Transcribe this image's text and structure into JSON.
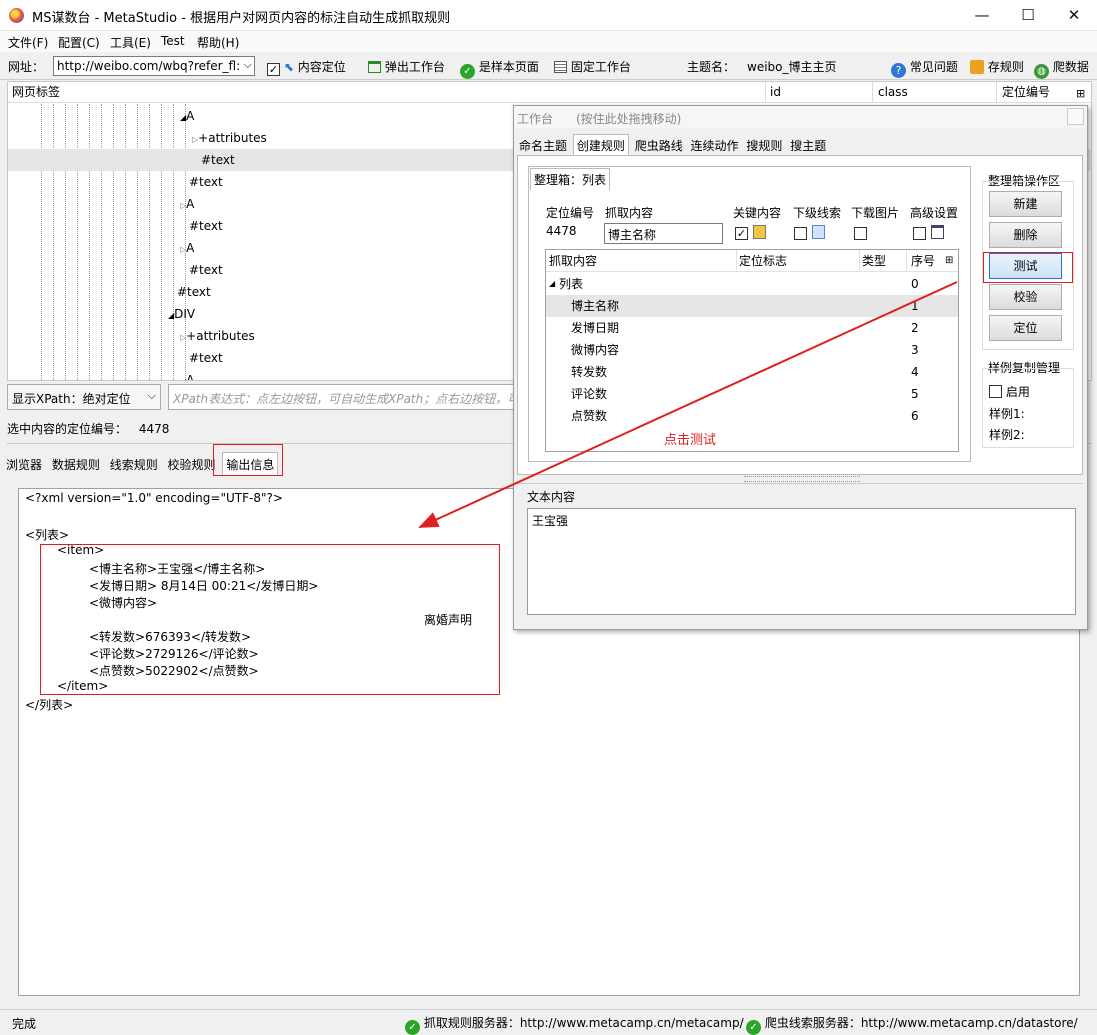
{
  "window": {
    "title": "MS谋数台 - MetaStudio - 根据用户对网页内容的标注自动生成抓取规则",
    "minimize": "—",
    "maximize": "☐",
    "close": "✕"
  },
  "menu": [
    "文件(F)",
    "配置(C)",
    "工具(E)",
    "Test",
    "帮助(H)"
  ],
  "toolbar": {
    "url_label": "网址：",
    "url_value": "http://weibo.com/wbq?refer_fl:",
    "content_locate": "内容定位",
    "popup_workbench": "弹出工作台",
    "is_sample_page": "是样本页面",
    "fix_workbench": "固定工作台",
    "theme_label": "主题名：",
    "theme_value": "weibo_博主主页",
    "faq": "常见问题",
    "save_rule": "存规则",
    "crawl_data": "爬数据"
  },
  "tree": {
    "headers": [
      "网页标签",
      "id",
      "class",
      "定位编号"
    ],
    "rows": [
      {
        "prefix": "◢",
        "label": "A"
      },
      {
        "prefix": "▷",
        "label": "+attributes"
      },
      {
        "prefix": "",
        "label": "#text"
      },
      {
        "prefix": "",
        "label": "#text"
      },
      {
        "prefix": "▷",
        "label": "A"
      },
      {
        "prefix": "",
        "label": "#text"
      },
      {
        "prefix": "▷",
        "label": "A"
      },
      {
        "prefix": "",
        "label": "#text"
      },
      {
        "prefix": "",
        "label": "#text"
      },
      {
        "prefix": "◢",
        "label": "DIV"
      },
      {
        "prefix": "▷",
        "label": "+attributes"
      },
      {
        "prefix": "",
        "label": "#text"
      },
      {
        "prefix": "◢",
        "label": "A"
      }
    ]
  },
  "xpath": {
    "mode": "显示XPath：绝对定位",
    "placeholder": "XPath表达式：点左边按钮，可自动生成XPath；点右边按钮，可"
  },
  "selected": {
    "label": "选中内容的定位编号：",
    "value": "4478"
  },
  "bottom_tabs": [
    "浏览器",
    "数据规则",
    "线索规则",
    "校验规则",
    "输出信息"
  ],
  "output": {
    "lines": [
      "<?xml version=\"1.0\" encoding=\"UTF-8\"?>",
      "<列表>",
      "<item>",
      "<博主名称>王宝强</博主名称>",
      "<发博日期> 8月14日 00:21</发博日期>",
      "<微博内容>",
      "离婚声明",
      "<转发数>676393</转发数>",
      "<评论数>2729126</评论数>",
      "<点赞数>5022902</点赞数>",
      "</item>",
      "</列表>"
    ]
  },
  "status": {
    "left": "完成",
    "rule_server": "抓取规则服务器：http://www.metacamp.cn/metacamp/",
    "clue_server": "爬虫线索服务器：http://www.metacamp.cn/datastore/"
  },
  "workbench": {
    "title": "工作台",
    "hint": "(按住此处拖拽移动)",
    "tabs": [
      "命名主题",
      "创建规则",
      "爬虫路线",
      "连续动作",
      "搜规则",
      "搜主题"
    ],
    "box_tab": "整理箱：列表",
    "field_labels": {
      "locate_no": "定位编号",
      "capture": "抓取内容",
      "key": "关键内容",
      "sub_clue": "下级线索",
      "download_img": "下载图片",
      "advanced": "高级设置"
    },
    "locate_value": "4478",
    "capture_value": "博主名称",
    "grid_headers": [
      "抓取内容",
      "定位标志",
      "类型",
      "序号"
    ],
    "grid_rows": [
      {
        "name": "列表",
        "seq": "0"
      },
      {
        "name": "博主名称",
        "seq": "1"
      },
      {
        "name": "发博日期",
        "seq": "2"
      },
      {
        "name": "微博内容",
        "seq": "3"
      },
      {
        "name": "转发数",
        "seq": "4"
      },
      {
        "name": "评论数",
        "seq": "5"
      },
      {
        "name": "点赞数",
        "seq": "6"
      }
    ],
    "annotation": "点击测试",
    "ops_title": "整理箱操作区",
    "ops_buttons": [
      "新建",
      "删除",
      "测试",
      "校验",
      "定位"
    ],
    "sample_title": "样例复制管理",
    "enable": "启用",
    "sample1": "样例1:",
    "sample2": "样例2:",
    "text_content_label": "文本内容",
    "text_content_value": "王宝强"
  },
  "colors": {
    "accent_red": "#e02020",
    "selection": "#e6e6e6",
    "green_check": "#2aa52a"
  }
}
